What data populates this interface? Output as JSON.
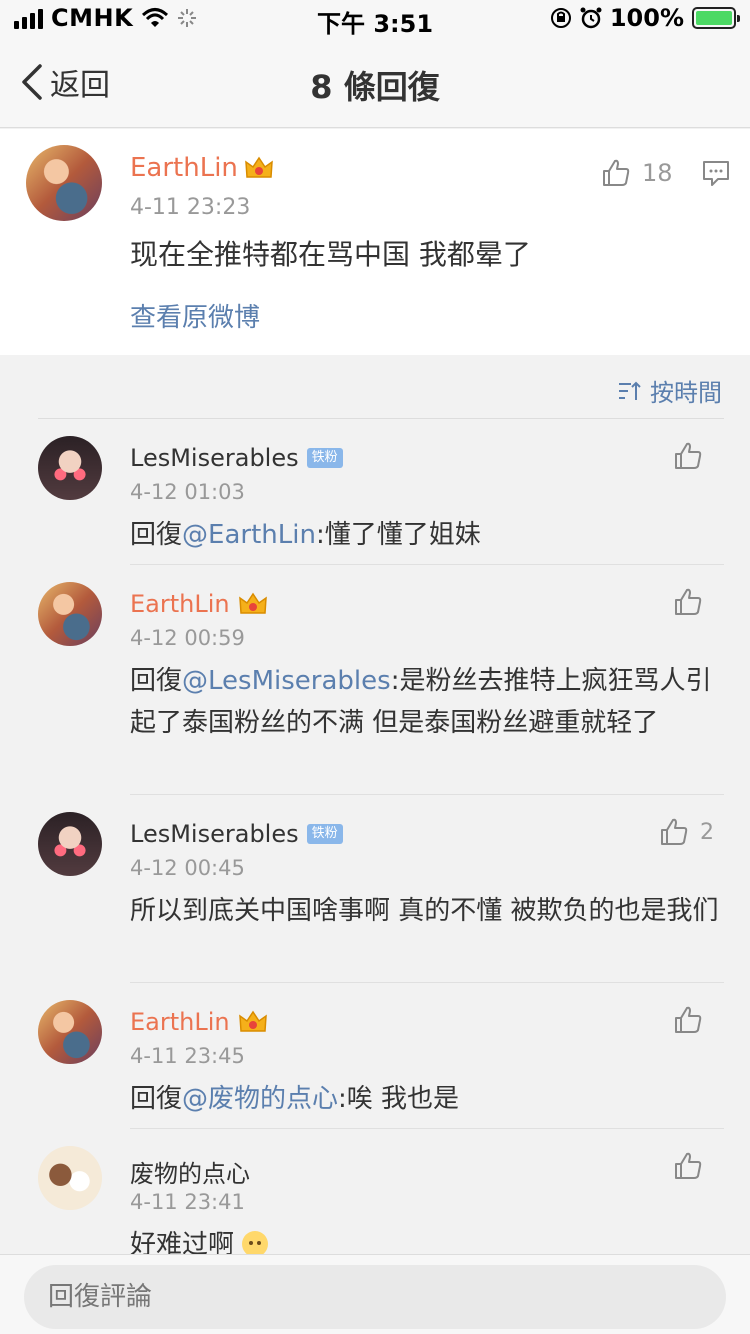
{
  "status_bar": {
    "carrier": "CMHK",
    "time": "下午 3:51",
    "battery": "100%"
  },
  "nav": {
    "back_label": "返回",
    "title": "8 條回復"
  },
  "main_post": {
    "author": "EarthLin",
    "time": "4-11 23:23",
    "text": "现在全推特都在骂中国 我都晕了",
    "likes": "18",
    "view_original": "查看原微博"
  },
  "sort": {
    "label": "按時間"
  },
  "comments": [
    {
      "author": "LesMiserables",
      "badge": "铁粉",
      "time": "4-12 01:03",
      "prefix": "回復",
      "mention": "@EarthLin",
      "text": ":懂了懂了姐妹",
      "likes": ""
    },
    {
      "author": "EarthLin",
      "time": "4-12 00:59",
      "prefix": "回復",
      "mention": "@LesMiserables",
      "text": ":是粉丝去推特上疯狂骂人引起了泰国粉丝的不满 但是泰国粉丝避重就轻了",
      "likes": ""
    },
    {
      "author": "LesMiserables",
      "badge": "铁粉",
      "time": "4-12 00:45",
      "text": "所以到底关中国啥事啊 真的不懂 被欺负的也是我们",
      "likes": "2"
    },
    {
      "author": "EarthLin",
      "time": "4-11 23:45",
      "prefix": "回復",
      "mention": "@废物的点心",
      "text": ":唉 我也是",
      "likes": ""
    },
    {
      "author": "废物的点心",
      "time": "4-11 23:41",
      "text": "好难过啊",
      "likes": ""
    }
  ],
  "bottom": {
    "reply_placeholder": "回復評論"
  },
  "colors": {
    "vip_name": "#eb7350",
    "link": "#5b7fae",
    "badge": "#8ab7ea"
  }
}
